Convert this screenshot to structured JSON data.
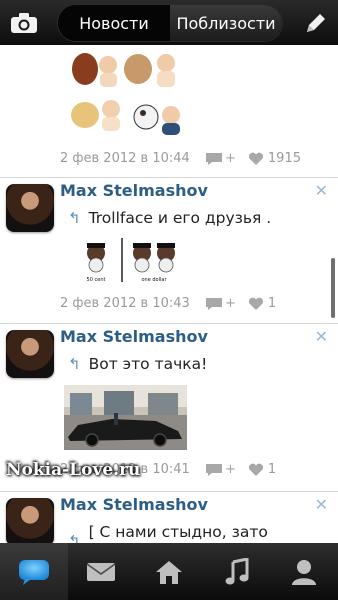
{
  "header": {
    "camera_icon": "camera-icon",
    "tabs": [
      {
        "label": "Новости",
        "active": true
      },
      {
        "label": "Поблизости",
        "active": false
      }
    ],
    "edit_icon": "pencil-icon"
  },
  "posts": [
    {
      "date": "2 фев 2012 в 10:44",
      "comment_label": "+",
      "likes": "1915",
      "image": "pets-and-babies-photo"
    },
    {
      "author": "Max Stelmashov",
      "text": "Trollface и его друзья .",
      "date": "2 фев 2012 в 10:43",
      "comment_label": "+",
      "likes": "1",
      "image_labels": [
        "50 cent",
        "one dollar"
      ]
    },
    {
      "author": "Max Stelmashov",
      "text": "Вот это тачка!",
      "date": "2 фев 2012 в 10:41",
      "comment_label": "+",
      "likes": "1",
      "image": "black-sports-car-photo"
    },
    {
      "author": "Max Stelmashov",
      "text": "[ С нами стыдно, зато весело..."
    }
  ],
  "watermark": "Nokia-Love.ru",
  "bottom_nav": [
    {
      "icon": "chat-bubble-icon",
      "active": true
    },
    {
      "icon": "envelope-icon",
      "active": false
    },
    {
      "icon": "home-icon",
      "active": false
    },
    {
      "icon": "music-note-icon",
      "active": false
    },
    {
      "icon": "profile-icon",
      "active": false
    }
  ],
  "colors": {
    "author": "#2e5e86",
    "accent_blue": "#3aa0e8",
    "meta_gray": "#9a9a9a"
  }
}
